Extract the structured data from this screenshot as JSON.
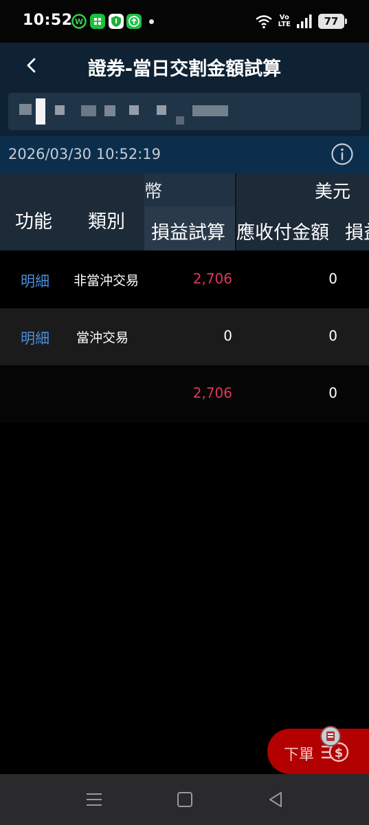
{
  "status_bar": {
    "time": "10:52",
    "volte_top": "Vo",
    "volte_bottom": "LTE",
    "battery": "77",
    "app_icons": [
      "webtoon-icon",
      "green-app-icon",
      "shield-app-icon",
      "upload-app-icon"
    ]
  },
  "header": {
    "title": "證券-當日交割金額試算"
  },
  "timestamp": "2026/03/30 10:52:19",
  "table": {
    "fixed_columns": [
      "功能",
      "類別"
    ],
    "group_1_label": "幣",
    "group_2_label": "美元",
    "sub_headers": [
      "損益試算",
      "應收付金額",
      "損益"
    ],
    "rows": [
      {
        "function": "明細",
        "category": "非當沖交易",
        "pl": "2,706",
        "receivable": "0"
      },
      {
        "function": "明細",
        "category": "當沖交易",
        "pl": "0",
        "receivable": "0"
      }
    ],
    "total": {
      "pl": "2,706",
      "receivable": "0"
    }
  },
  "order_button": {
    "label": "下單"
  },
  "colors": {
    "header_bg": "#0f2234",
    "timebar_bg": "#0c2e4d",
    "link_blue": "#4b8fdc",
    "profit_red": "#e0365c",
    "order_red": "#b30000"
  }
}
